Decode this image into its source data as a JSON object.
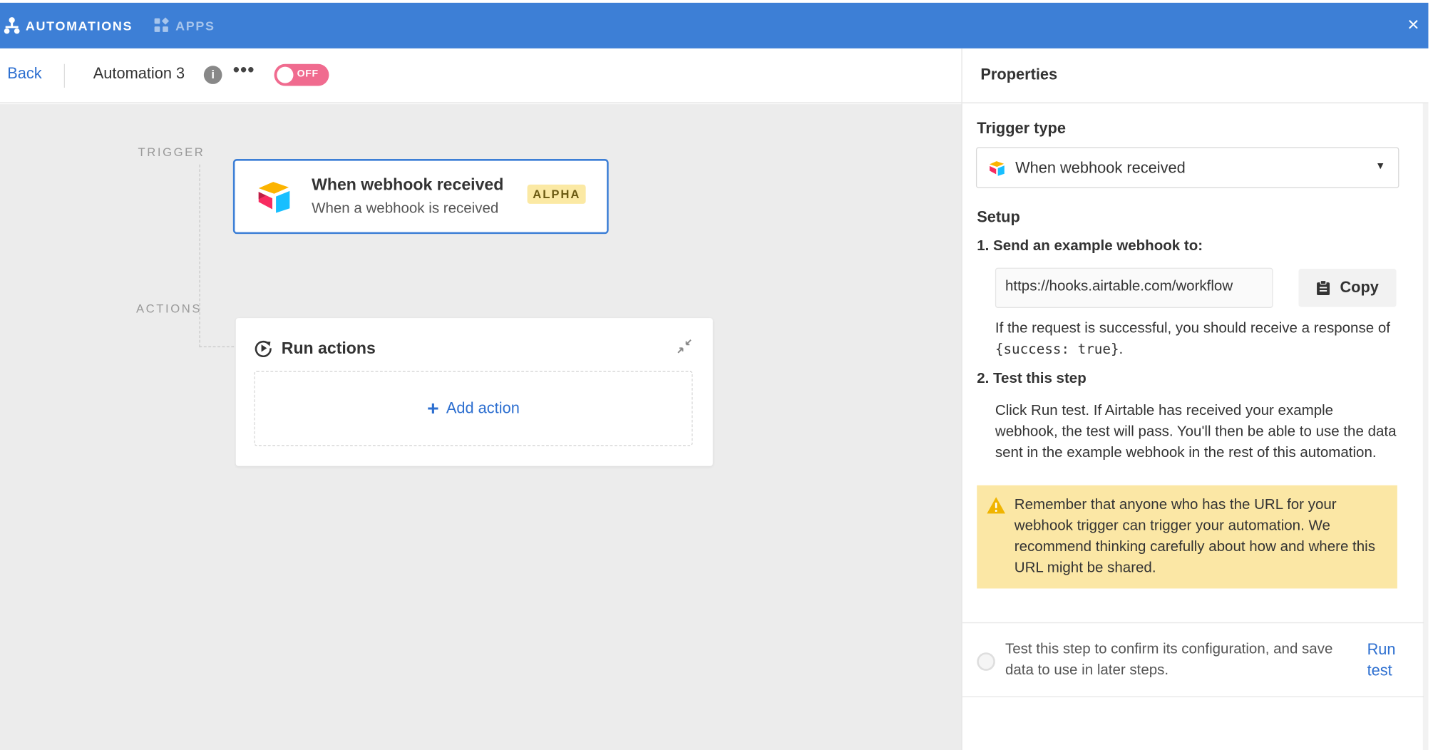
{
  "topbar": {
    "automations_label": "AUTOMATIONS",
    "apps_label": "APPS",
    "close_glyph": "×",
    "color": "#3d7fd6"
  },
  "header": {
    "back_label": "Back",
    "automation_name": "Automation 3",
    "info_glyph": "i",
    "more_glyph": "•••",
    "toggle_label": "OFF",
    "toggle_color": "#f06b8f"
  },
  "canvas": {
    "trigger_lane_label": "TRIGGER",
    "actions_lane_label": "ACTIONS",
    "trigger_card": {
      "title": "When webhook received",
      "subtitle": "When a webhook is received",
      "badge": "ALPHA",
      "icon": "airtable-logo-icon"
    },
    "actions_card": {
      "title": "Run actions",
      "add_action_plus": "+",
      "add_action_label": "Add action"
    }
  },
  "properties": {
    "title": "Properties",
    "trigger_type_label": "Trigger type",
    "trigger_type_value": "When webhook received",
    "setup_label": "Setup",
    "step1_label": "1. Send an example webhook to:",
    "webhook_url": "https://hooks.airtable.com/workflow",
    "copy_label": "Copy",
    "success_text_before": "If the request is successful, you should receive a response of",
    "success_code": "{success: true}",
    "success_text_after": ".",
    "step2_label": "2. Test this step",
    "step2_text": "Click Run test. If Airtable has received your example webhook, the test will pass. You'll then be able to use the data sent in the example webhook in the rest of this automation.",
    "warning_text": "Remember that anyone who has the URL for your webhook trigger can trigger your automation. We recommend thinking carefully about how and where this URL might be shared.",
    "warning_color": "#fbe7a5",
    "test_text": "Test this step to confirm its configuration, and save data to use in later steps.",
    "run_test_label": "Run test",
    "link_color": "#2d6fd0"
  }
}
